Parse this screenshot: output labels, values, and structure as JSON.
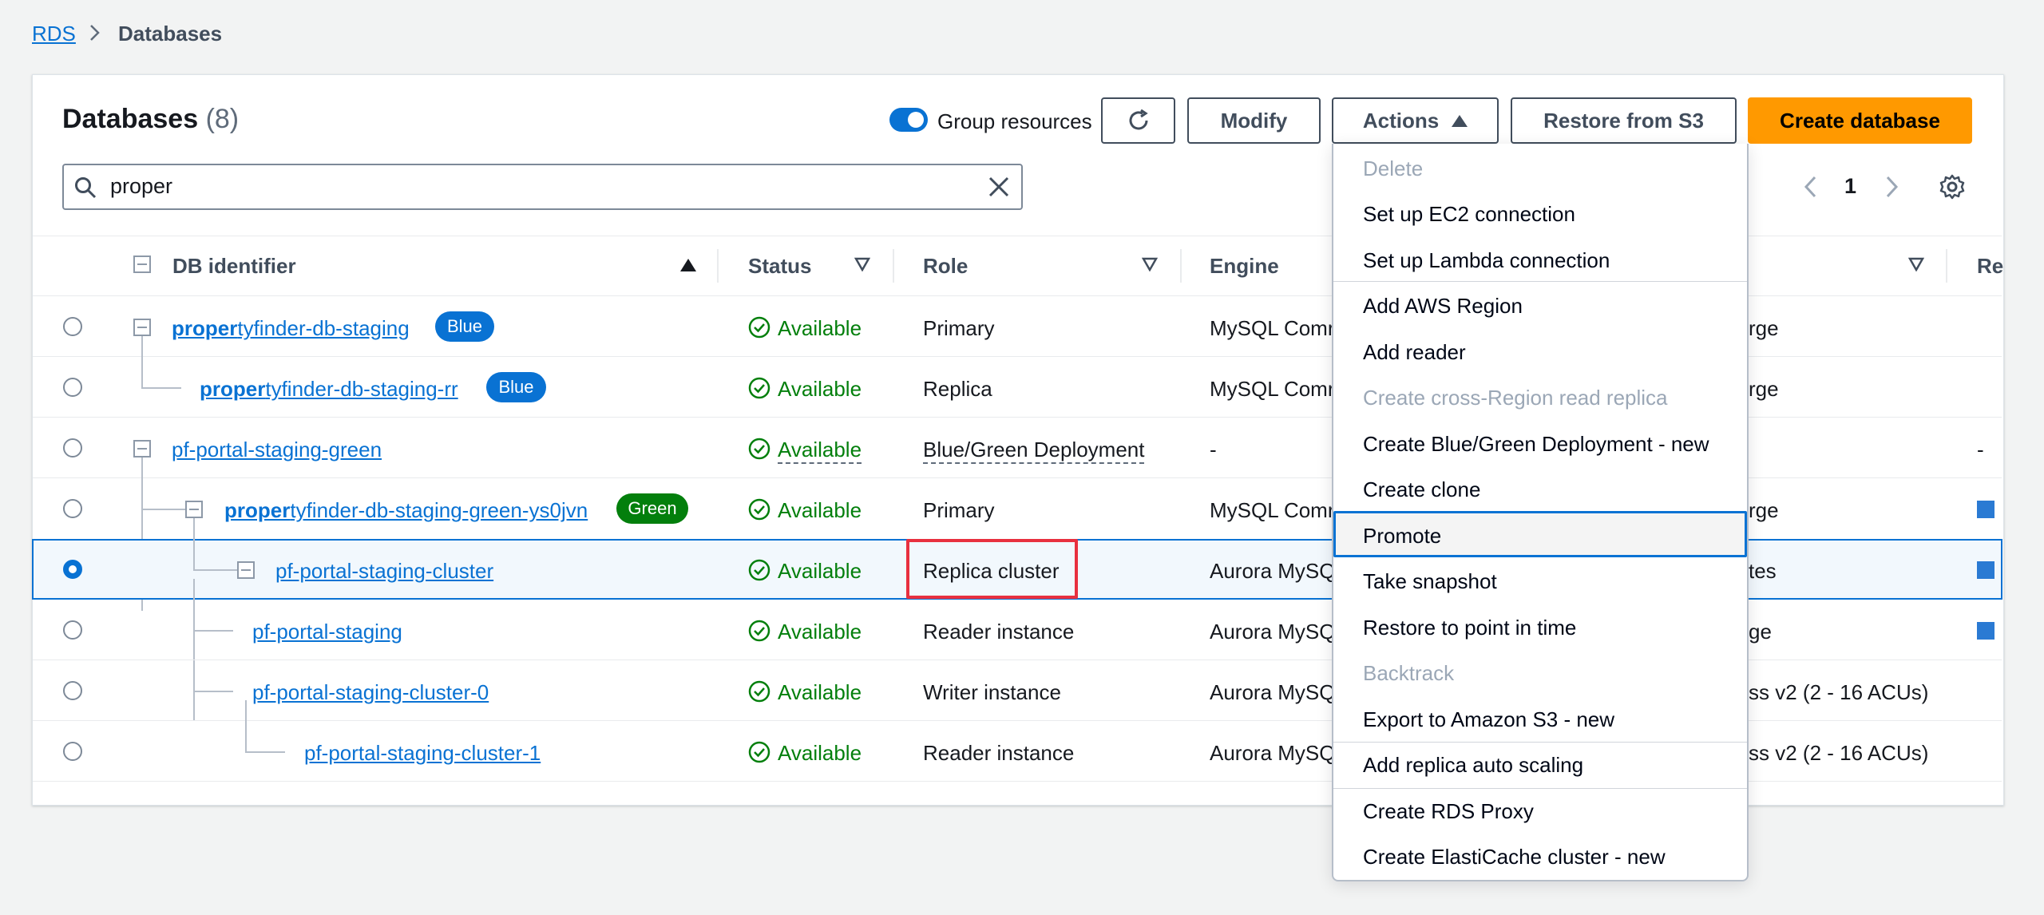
{
  "breadcrumb": {
    "root": "RDS",
    "current": "Databases"
  },
  "header": {
    "title": "Databases",
    "count": "(8)",
    "group_resources_label": "Group resources",
    "group_resources_on": true,
    "modify_label": "Modify",
    "actions_label": "Actions",
    "restore_label": "Restore from S3",
    "create_label": "Create database",
    "accent_color": "#ff9900"
  },
  "search": {
    "value": "proper"
  },
  "pagination": {
    "current_page": "1"
  },
  "table": {
    "columns": [
      "DB identifier",
      "Status",
      "Role",
      "Engine",
      "Re"
    ],
    "rows": [
      {
        "id_match": "proper",
        "id_rest": "tyfinder-db-staging",
        "badge": "Blue",
        "status": "Available",
        "role": "Primary",
        "engine": "MySQL Comr",
        "extra": "rge",
        "extra2": "",
        "selected": false
      },
      {
        "id_match": "proper",
        "id_rest": "tyfinder-db-staging-rr",
        "badge": "Blue",
        "status": "Available",
        "role": "Replica",
        "engine": "MySQL Comr",
        "extra": "rge",
        "extra2": "",
        "selected": false
      },
      {
        "id_match": "",
        "id_rest": "pf-portal-staging-green",
        "badge": "",
        "status": "Available",
        "role": "Blue/Green Deployment",
        "engine": "-",
        "extra": "",
        "extra2": "-",
        "selected": false
      },
      {
        "id_match": "proper",
        "id_rest": "tyfinder-db-staging-green-ys0jvn",
        "badge": "Green",
        "status": "Available",
        "role": "Primary",
        "engine": "MySQL Comr",
        "extra": "rge",
        "extra2": "",
        "selected": false
      },
      {
        "id_match": "",
        "id_rest": "pf-portal-staging-cluster",
        "badge": "",
        "status": "Available",
        "role": "Replica cluster",
        "engine": "Aurora MySQ",
        "extra": "tes",
        "extra2": "",
        "selected": true
      },
      {
        "id_match": "",
        "id_rest": "pf-portal-staging",
        "badge": "",
        "status": "Available",
        "role": "Reader instance",
        "engine": "Aurora MySQ",
        "extra": "ge",
        "extra2": "",
        "selected": false
      },
      {
        "id_match": "",
        "id_rest": "pf-portal-staging-cluster-0",
        "badge": "",
        "status": "Available",
        "role": "Writer instance",
        "engine": "Aurora MySQ",
        "extra": "ss v2 (2 - 16 ACUs)",
        "extra2": "",
        "selected": false
      },
      {
        "id_match": "",
        "id_rest": "pf-portal-staging-cluster-1",
        "badge": "",
        "status": "Available",
        "role": "Reader instance",
        "engine": "Aurora MySQ",
        "extra": "ss v2 (2 - 16 ACUs)",
        "extra2": "",
        "selected": false
      }
    ]
  },
  "actions_menu": {
    "items": [
      {
        "label": "Delete",
        "disabled": true
      },
      {
        "label": "Set up EC2 connection",
        "disabled": false
      },
      {
        "label": "Set up Lambda connection",
        "disabled": false
      },
      {
        "label": "Add AWS Region",
        "disabled": false
      },
      {
        "label": "Add reader",
        "disabled": false
      },
      {
        "label": "Create cross-Region read replica",
        "disabled": true
      },
      {
        "label": "Create Blue/Green Deployment - new",
        "disabled": false
      },
      {
        "label": "Create clone",
        "disabled": false
      },
      {
        "label": "Promote",
        "disabled": false,
        "highlighted": true
      },
      {
        "label": "Take snapshot",
        "disabled": false
      },
      {
        "label": "Restore to point in time",
        "disabled": false
      },
      {
        "label": "Backtrack",
        "disabled": true
      },
      {
        "label": "Export to Amazon S3 - new",
        "disabled": false
      },
      {
        "label": "Add replica auto scaling",
        "disabled": false
      },
      {
        "label": "Create RDS Proxy",
        "disabled": false
      },
      {
        "label": "Create ElastiCache cluster - new",
        "disabled": false
      }
    ]
  }
}
